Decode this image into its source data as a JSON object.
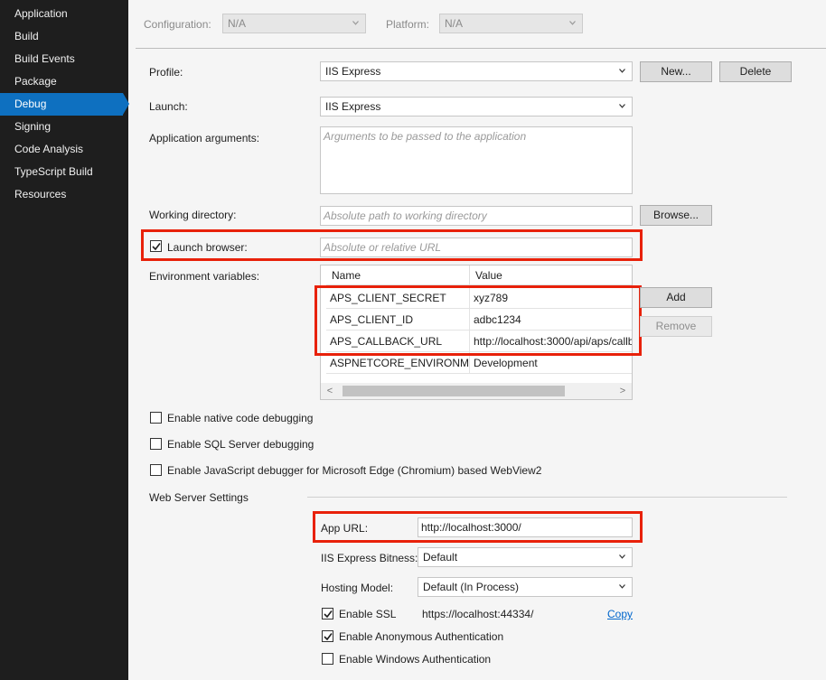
{
  "sidebar": {
    "items": [
      {
        "label": "Application"
      },
      {
        "label": "Build"
      },
      {
        "label": "Build Events"
      },
      {
        "label": "Package"
      },
      {
        "label": "Debug",
        "active": true
      },
      {
        "label": "Signing"
      },
      {
        "label": "Code Analysis"
      },
      {
        "label": "TypeScript Build"
      },
      {
        "label": "Resources"
      }
    ]
  },
  "header": {
    "configuration_label": "Configuration:",
    "configuration_value": "N/A",
    "platform_label": "Platform:",
    "platform_value": "N/A"
  },
  "profile": {
    "label": "Profile:",
    "value": "IIS Express",
    "new_button": "New...",
    "delete_button": "Delete"
  },
  "launch": {
    "label": "Launch:",
    "value": "IIS Express"
  },
  "app_args": {
    "label": "Application arguments:",
    "placeholder": "Arguments to be passed to the application"
  },
  "working_dir": {
    "label": "Working directory:",
    "placeholder": "Absolute path to working directory",
    "browse_button": "Browse..."
  },
  "launch_browser": {
    "label": "Launch browser:",
    "checked": true,
    "placeholder": "Absolute or relative URL"
  },
  "env_vars": {
    "label": "Environment variables:",
    "columns": [
      "Name",
      "Value"
    ],
    "rows": [
      {
        "name": "APS_CLIENT_SECRET",
        "value": "xyz789"
      },
      {
        "name": "APS_CLIENT_ID",
        "value": "adbc1234"
      },
      {
        "name": "APS_CALLBACK_URL",
        "value": "http://localhost:3000/api/aps/callb"
      },
      {
        "name": "ASPNETCORE_ENVIRONMENT",
        "value": "Development"
      }
    ],
    "add_button": "Add",
    "remove_button": "Remove",
    "scroll_left": "<",
    "scroll_right": ">"
  },
  "options": {
    "native_debugging": {
      "label": "Enable native code debugging",
      "checked": false
    },
    "sql_debugging": {
      "label": "Enable SQL Server debugging",
      "checked": false
    },
    "js_debugging": {
      "label": "Enable JavaScript debugger for Microsoft Edge (Chromium) based WebView2",
      "checked": false
    }
  },
  "web_server": {
    "section_label": "Web Server Settings",
    "app_url_label": "App URL:",
    "app_url_value": "http://localhost:3000/",
    "bitness_label": "IIS Express Bitness:",
    "bitness_value": "Default",
    "hosting_label": "Hosting Model:",
    "hosting_value": "Default (In Process)",
    "ssl_label": "Enable SSL",
    "ssl_checked": true,
    "ssl_url": "https://localhost:44334/",
    "copy_link": "Copy",
    "anon_auth_label": "Enable Anonymous Authentication",
    "anon_auth_checked": true,
    "windows_auth_label": "Enable Windows Authentication",
    "windows_auth_checked": false
  },
  "colors": {
    "sidebar_bg": "#1e1e1e",
    "active_item": "#0e70c0",
    "highlight_box": "#e8210a",
    "link": "#0066cc"
  }
}
